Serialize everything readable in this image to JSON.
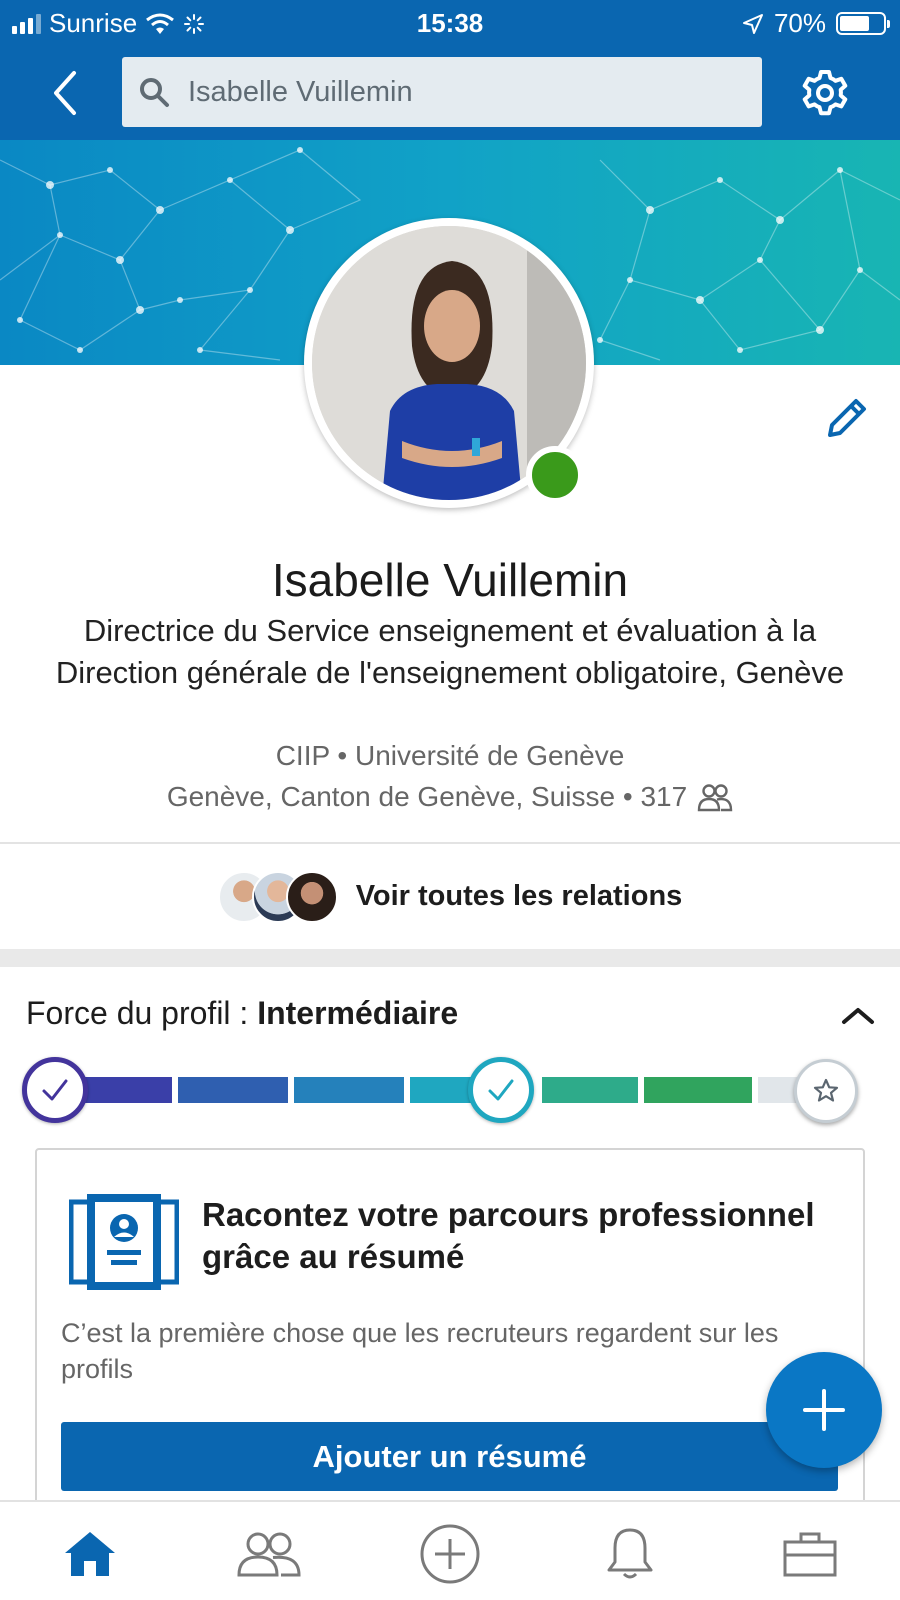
{
  "status_bar": {
    "carrier": "Sunrise",
    "time": "15:38",
    "battery": "70%",
    "battery_level": 0.7
  },
  "nav": {
    "search_value": "Isabelle Vuillemin",
    "icons": [
      "chevron-left-icon",
      "search-icon",
      "gear-icon"
    ]
  },
  "profile": {
    "name": "Isabelle Vuillemin",
    "headline": "Directrice du Service enseignement et évaluation à la Direction générale de l'enseignement obligatoire, Genève",
    "company": "CIIP • Université de Genève",
    "location": "Genève, Canton de Genève, Suisse • 317",
    "online": true
  },
  "connections": {
    "label": "Voir toutes les relations"
  },
  "strength": {
    "label": "Force du profil : ",
    "level": "Intermédiaire",
    "steps_completed": 2,
    "steps_total": 3,
    "colors": [
      "#3a3fa8",
      "#2f6fb8",
      "#1fa4b9",
      "#2aa46a",
      "#e1e6ea"
    ]
  },
  "card": {
    "title": "Racontez votre parcours professionnel grâce au résumé",
    "description": "C’est la première chose que les recruteurs regardent sur les profils",
    "button_label": "Ajouter un résumé"
  },
  "tab_bar": {
    "tabs": [
      "home-icon",
      "network-icon",
      "post-icon",
      "notifications-icon",
      "jobs-icon"
    ],
    "active": "home-icon"
  },
  "colors": {
    "brand_blue": "#0a66b0",
    "online_green": "#3a9a1b"
  }
}
